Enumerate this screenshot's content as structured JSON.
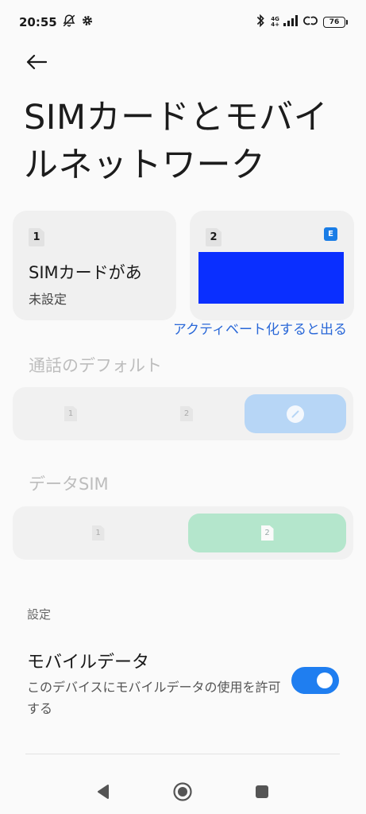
{
  "status_bar": {
    "time": "20:55",
    "network_type": "4G",
    "network_sub": "4+",
    "battery": "76",
    "icons": [
      "silent-bell-icon",
      "gear-icon",
      "bluetooth-icon",
      "signal-icon",
      "link-icon",
      "battery-icon"
    ]
  },
  "header": {
    "title": "SIMカードとモバイルネットワーク"
  },
  "sim_cards": [
    {
      "slot": "1",
      "title": "SIMカードがあ",
      "subtitle": "未設定"
    },
    {
      "slot": "2",
      "badge": "E",
      "block_color": "#0a2fff"
    }
  ],
  "activate_link": "アクティベート化すると出る",
  "call_default": {
    "heading": "通話のデフォルト",
    "options": [
      "1",
      "2"
    ],
    "selected_color": "#b7d6f6"
  },
  "data_sim": {
    "heading": "データSIM",
    "options": [
      "1",
      "2"
    ],
    "selected_color": "#b4e6cc"
  },
  "settings": {
    "heading": "設定",
    "mobile_data": {
      "title": "モバイルデータ",
      "description": "このデバイスにモバイルデータの使用を許可する",
      "enabled": true
    }
  },
  "colors": {
    "accent": "#1f7ef0",
    "link": "#2a68d8",
    "background": "#fafafa",
    "card": "#f0f0f0"
  }
}
